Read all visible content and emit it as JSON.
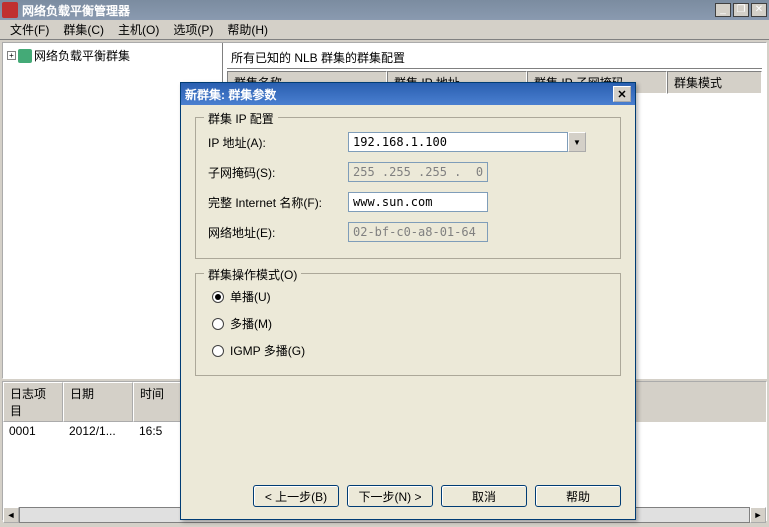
{
  "window": {
    "title": "网络负载平衡管理器"
  },
  "menu": {
    "file": "文件(F)",
    "cluster": "群集(C)",
    "host": "主机(O)",
    "options": "选项(P)",
    "help": "帮助(H)"
  },
  "tree": {
    "root": "网络负载平衡群集"
  },
  "rightPane": {
    "header": "所有已知的 NLB 群集的群集配置",
    "cols": {
      "name": "群集名称",
      "ip": "群集 IP 地址",
      "mask": "群集 IP 子网掩码",
      "mode": "群集模式"
    }
  },
  "log": {
    "cols": {
      "item": "日志项目",
      "date": "日期",
      "time": "时间"
    },
    "rows": [
      {
        "item": "0001",
        "date": "2012/1...",
        "time": "16:5"
      }
    ]
  },
  "dialog": {
    "title": "新群集:    群集参数",
    "group1": {
      "legend": "群集 IP 配置",
      "ip_label": "IP 地址(A):",
      "ip_value": "192.168.1.100",
      "mask_label": "子网掩码(S):",
      "mask_value": "255 .255 .255 .  0",
      "fqdn_label": "完整 Internet 名称(F):",
      "fqdn_value": "www.sun.com",
      "mac_label": "网络地址(E):",
      "mac_value": "02-bf-c0-a8-01-64"
    },
    "group2": {
      "legend": "群集操作模式(O)",
      "opt1": "单播(U)",
      "opt2": "多播(M)",
      "opt3": "IGMP 多播(G)"
    },
    "buttons": {
      "back": "< 上一步(B)",
      "next": "下一步(N) >",
      "cancel": "取消",
      "help": "帮助"
    }
  }
}
